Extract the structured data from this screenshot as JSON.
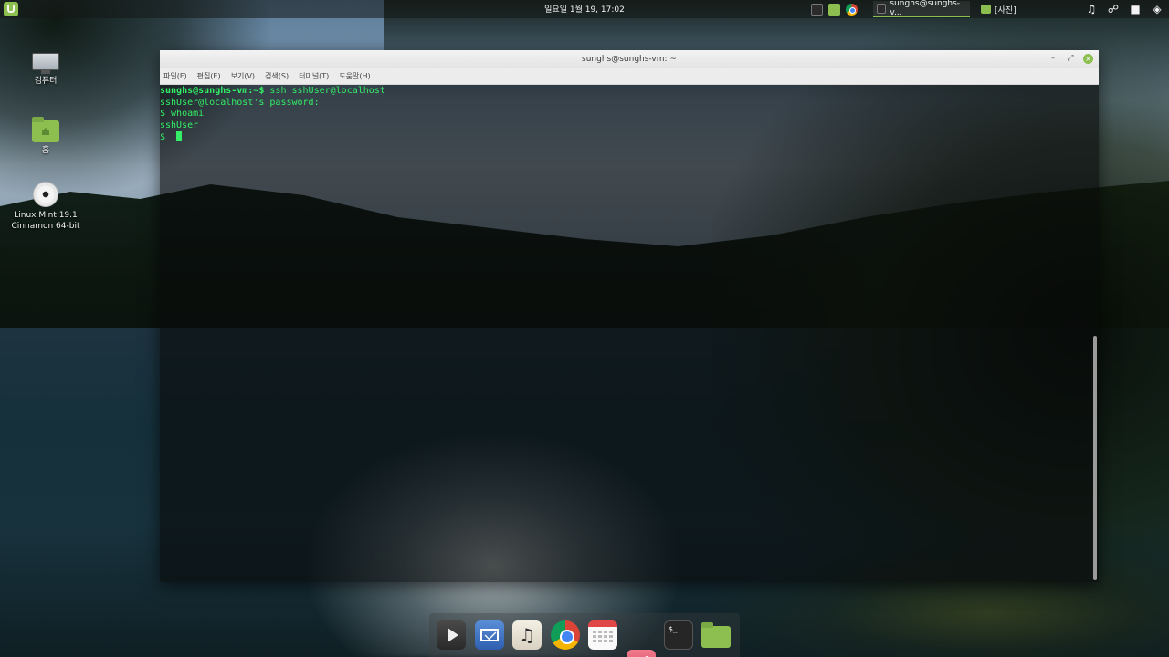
{
  "top_panel": {
    "clock": "일요일 1월 19, 17:02",
    "taskbar_items": [
      {
        "label": "sunghs@sunghs-v...",
        "icon": "terminal-icon",
        "active": true
      },
      {
        "label": "[사진]",
        "icon": "folder-icon",
        "active": false
      }
    ],
    "tray_icons": [
      "music-note-icon",
      "network-icon",
      "trash-icon",
      "updates-shield-icon"
    ]
  },
  "desktop_icons": [
    {
      "label": "컴퓨터",
      "icon": "computer-icon"
    },
    {
      "label": "홈",
      "icon": "home-folder-icon"
    },
    {
      "label": "Linux Mint 19.1\nCinnamon 64-bit",
      "icon": "disc-icon"
    }
  ],
  "terminal": {
    "title": "sunghs@sunghs-vm: ~",
    "menu": [
      "파일(F)",
      "편집(E)",
      "보기(V)",
      "검색(S)",
      "터미널(T)",
      "도움말(H)"
    ],
    "lines": [
      {
        "prompt": "sunghs@sunghs-vm:~$",
        "text": " ssh sshUser@localhost"
      },
      {
        "prompt": "",
        "text": "sshUser@localhost's password:"
      },
      {
        "prompt": "",
        "text": "$ whoami"
      },
      {
        "prompt": "",
        "text": "sshUser"
      },
      {
        "prompt": "",
        "text": "$ "
      }
    ],
    "text_color": "#33ee66"
  },
  "dock": {
    "items": [
      "media-player-icon",
      "mail-icon",
      "music-icon",
      "chrome-icon",
      "calendar-icon",
      "photos-icon",
      "terminal-icon",
      "folder-icon"
    ],
    "terminal_glyph": "$_"
  },
  "colors": {
    "accent": "#8cbf4f"
  }
}
